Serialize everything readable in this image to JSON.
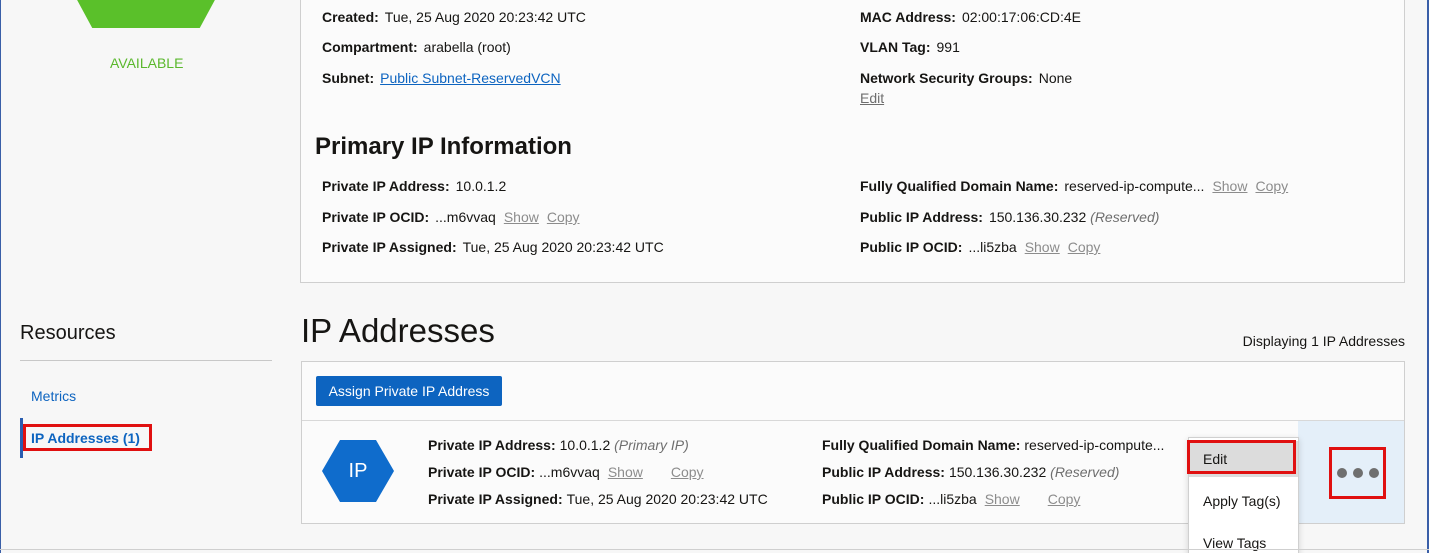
{
  "status": {
    "label": "AVAILABLE",
    "color": "#5ac02a"
  },
  "vnic_info": {
    "created_label": "Created:",
    "created_value": "Tue, 25 Aug 2020 20:23:42 UTC",
    "compartment_label": "Compartment:",
    "compartment_value": "arabella (root)",
    "subnet_label": "Subnet:",
    "subnet_value": "Public Subnet-ReservedVCN",
    "mac_label": "MAC Address:",
    "mac_value": "02:00:17:06:CD:4E",
    "vlan_label": "VLAN Tag:",
    "vlan_value": "991",
    "nsg_label": "Network Security Groups:",
    "nsg_value": "None",
    "nsg_edit": "Edit"
  },
  "primary_ip": {
    "title": "Primary IP Information",
    "private_ip_label": "Private IP Address:",
    "private_ip_value": "10.0.1.2",
    "ocid_label": "Private IP OCID:",
    "ocid_value": "...m6vvaq",
    "assigned_label": "Private IP Assigned:",
    "assigned_value": "Tue, 25 Aug 2020 20:23:42 UTC",
    "fqdn_label": "Fully Qualified Domain Name:",
    "fqdn_value": "reserved-ip-compute...",
    "public_ip_label": "Public IP Address:",
    "public_ip_value": "150.136.30.232",
    "public_ip_note": "(Reserved)",
    "public_ocid_label": "Public IP OCID:",
    "public_ocid_value": "...li5zba",
    "show": "Show",
    "copy": "Copy"
  },
  "resources": {
    "title": "Resources",
    "items": [
      {
        "label": "Metrics"
      },
      {
        "label": "IP Addresses (1)"
      }
    ]
  },
  "ip_addresses": {
    "title": "IP Addresses",
    "displaying": "Displaying 1 IP Addresses",
    "assign_button": "Assign Private IP Address",
    "row": {
      "icon_text": "IP",
      "private_ip_label": "Private IP Address:",
      "private_ip_value": "10.0.1.2",
      "private_ip_note": "(Primary IP)",
      "ocid_label": "Private IP OCID:",
      "ocid_value": "...m6vvaq",
      "assigned_label": "Private IP Assigned:",
      "assigned_value": "Tue, 25 Aug 2020 20:23:42 UTC",
      "fqdn_label": "Fully Qualified Domain Name:",
      "fqdn_value": "reserved-ip-compute...",
      "public_ip_label": "Public IP Address:",
      "public_ip_value": "150.136.30.232",
      "public_ip_note": "(Reserved)",
      "public_ocid_label": "Public IP OCID:",
      "public_ocid_value": "...li5zba",
      "show": "Show",
      "copy": "Copy"
    },
    "menu": {
      "items": [
        {
          "label": "Edit"
        },
        {
          "label": "Apply Tag(s)"
        },
        {
          "label": "View Tags"
        }
      ]
    }
  },
  "colors": {
    "accent": "#0d64c0",
    "highlight_box": "#e01010"
  }
}
